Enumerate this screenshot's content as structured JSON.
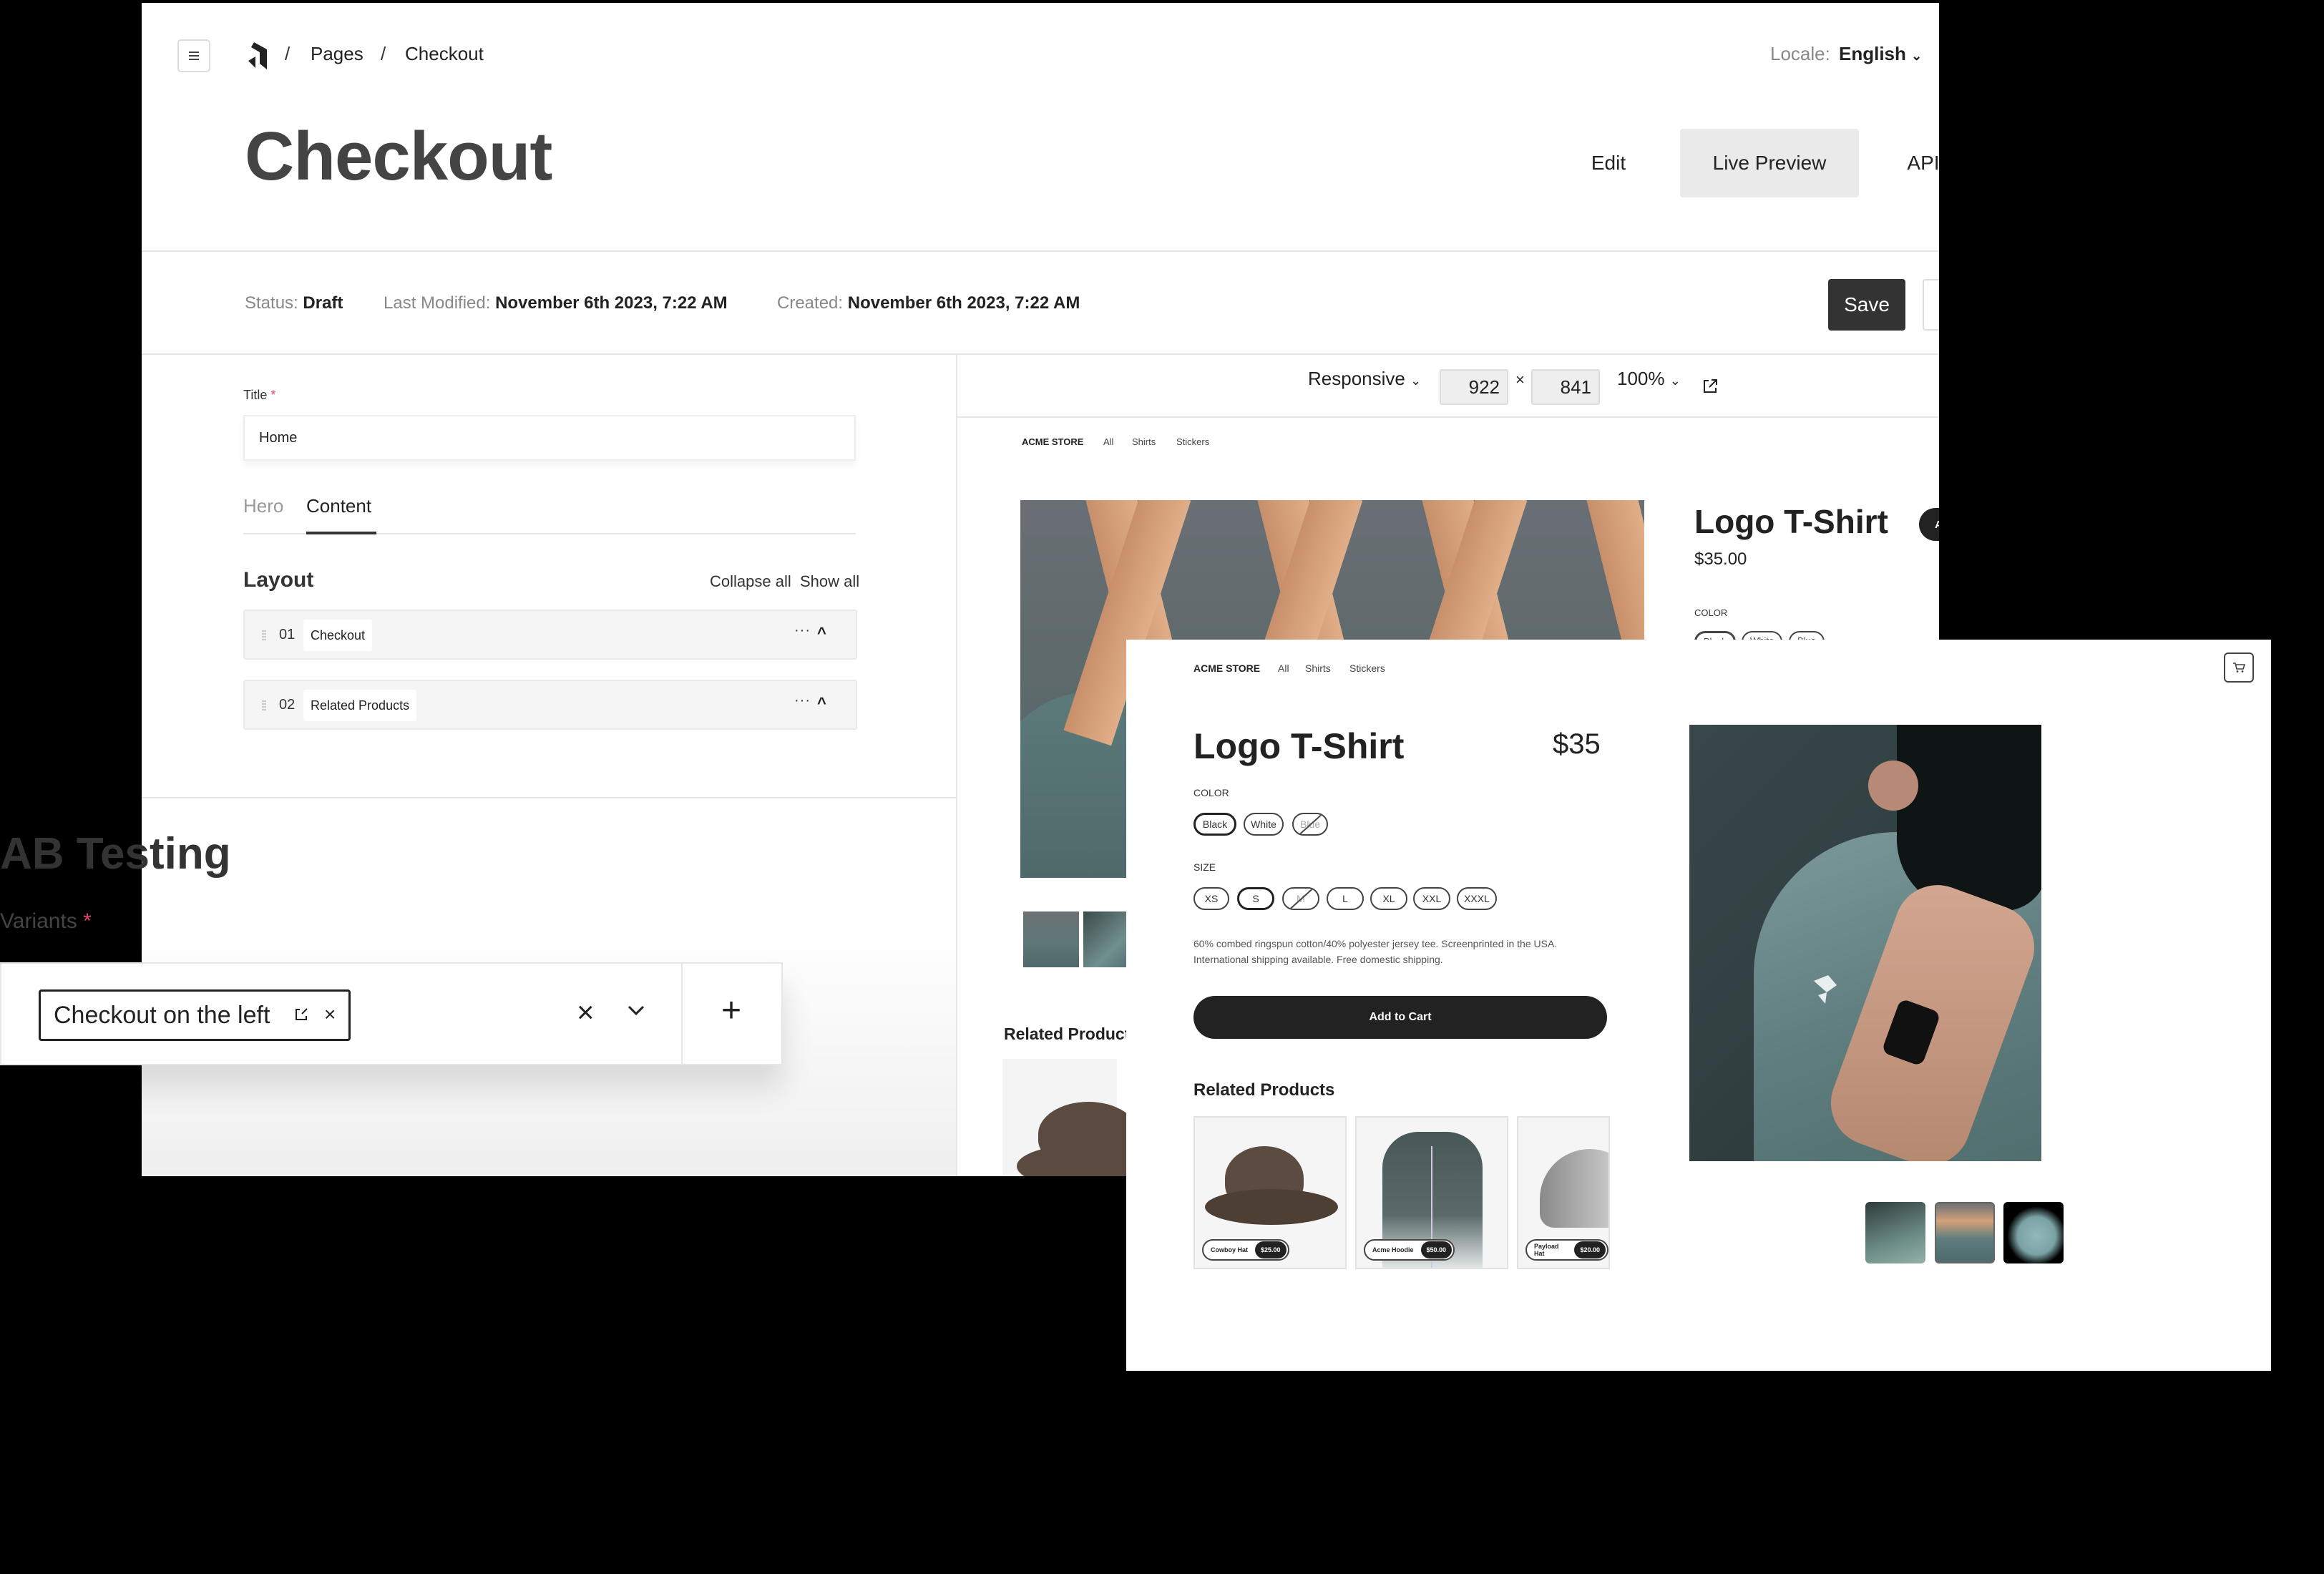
{
  "header": {
    "breadcrumb": [
      "Pages",
      "Checkout"
    ],
    "breadcrumb_separator": "/",
    "locale_label": "Locale:",
    "locale_value": "English",
    "page_title": "Checkout",
    "view_tabs": [
      {
        "label": "Edit",
        "active": false
      },
      {
        "label": "Live Preview",
        "active": true
      },
      {
        "label": "API",
        "active": false
      }
    ]
  },
  "meta": {
    "status_label": "Status:",
    "status_value": "Draft",
    "modified_label": "Last Modified:",
    "modified_value": "November 6th 2023, 7:22 AM",
    "created_label": "Created:",
    "created_value": "November 6th 2023, 7:22 AM",
    "save_label": "Save"
  },
  "editor": {
    "title_label": "Title",
    "required_mark": "*",
    "title_value": "Home",
    "tabs": [
      {
        "label": "Hero",
        "active": false
      },
      {
        "label": "Content",
        "active": true
      }
    ],
    "layout_heading": "Layout",
    "collapse_all": "Collapse all",
    "show_all": "Show all",
    "blocks": [
      {
        "num": "01",
        "name": "Checkout"
      },
      {
        "num": "02",
        "name": "Related Products"
      }
    ],
    "block_more": "···",
    "block_caret": "^"
  },
  "ab_testing": {
    "title": "AB Testing",
    "variants_label": "Variants",
    "required_mark": "*",
    "selected_variant": "Checkout on the left",
    "chip_remove": "×",
    "clear": "×",
    "add": "+"
  },
  "preview_toolbar": {
    "mode": "Responsive",
    "width": "922",
    "times": "×",
    "height": "841",
    "zoom": "100%"
  },
  "preview_site": {
    "brand": "ACME STORE",
    "nav": [
      "All",
      "Shirts",
      "Stickers"
    ],
    "product_title": "Logo T-Shirt",
    "add_to_cart": "Add to Cart",
    "price": "$35.00",
    "color_label": "COLOR",
    "colors": [
      "Black",
      "White",
      "Blue"
    ],
    "related_heading": "Related Products"
  },
  "overlay_site": {
    "brand": "ACME STORE",
    "nav": [
      "All",
      "Shirts",
      "Stickers"
    ],
    "product_title": "Logo T-Shirt",
    "price": "$35",
    "color_label": "COLOR",
    "colors": [
      {
        "label": "Black",
        "state": "selected"
      },
      {
        "label": "White",
        "state": "available"
      },
      {
        "label": "Blue",
        "state": "unavailable"
      }
    ],
    "size_label": "SIZE",
    "sizes": [
      {
        "label": "XS",
        "state": "available"
      },
      {
        "label": "S",
        "state": "selected"
      },
      {
        "label": "M",
        "state": "unavailable"
      },
      {
        "label": "L",
        "state": "available"
      },
      {
        "label": "XL",
        "state": "available"
      },
      {
        "label": "XXL",
        "state": "available"
      },
      {
        "label": "XXXL",
        "state": "available"
      }
    ],
    "description_line1": "60% combed ringspun cotton/40% polyester jersey tee. Screenprinted in the USA.",
    "description_line2": "International shipping available. Free domestic shipping.",
    "add_to_cart": "Add to Cart",
    "related_heading": "Related Products",
    "related_products": [
      {
        "name": "Cowboy Hat",
        "price": "$25.00"
      },
      {
        "name": "Acme Hoodie",
        "price": "$50.00"
      },
      {
        "name": "Payload Hat",
        "price": "$20.00"
      }
    ]
  },
  "colors": {
    "primary_dark": "#222222",
    "save_bg": "#333333",
    "required": "#e04a6b",
    "active_tab_bg": "#eaeaea",
    "shirt": "#5f7d7e"
  }
}
